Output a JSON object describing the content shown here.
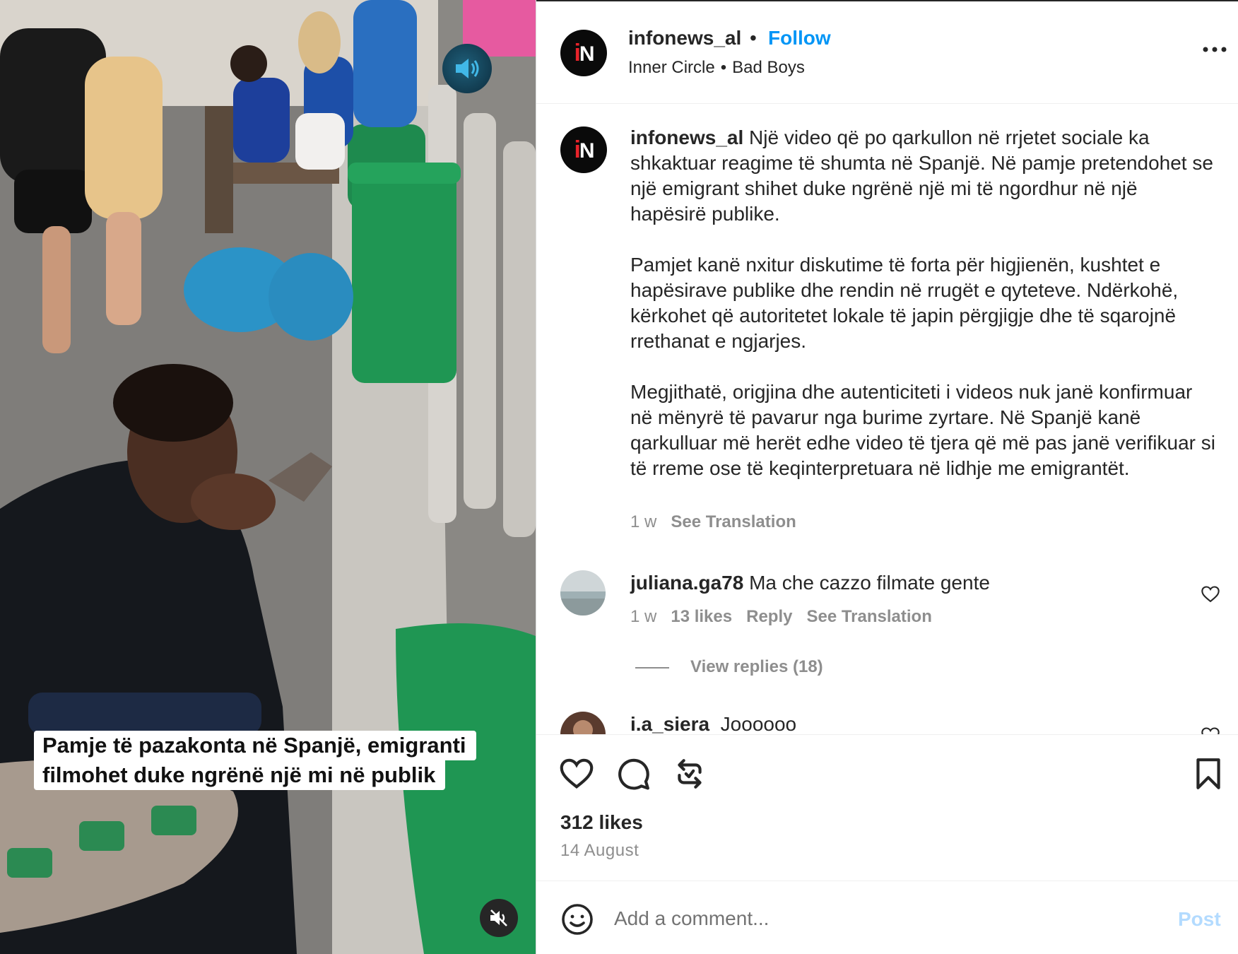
{
  "media": {
    "caption_line1": "Pamje të pazakonta në Spanjë, emigranti",
    "caption_line2": "filmohet duke ngrënë një mi në publik",
    "audio_icon": "speaker-icon",
    "mute_icon": "volume-muted-icon"
  },
  "header": {
    "avatar_text": "iN",
    "username": "infonews_al",
    "separator": "•",
    "follow": "Follow",
    "audio_artist": "Inner Circle",
    "audio_sep": "•",
    "audio_track": "Bad Boys",
    "more_icon": "more-horizontal-icon"
  },
  "caption": {
    "username": "infonews_al",
    "paragraph1": "Një video që po qarkullon në rrjetet sociale ka shkaktuar reagime të shumta në Spanjë. Në pamje pretendohet se një emigrant shihet duke ngrënë një mi të ngordhur në një hapësirë publike.",
    "paragraph2": "Pamjet kanë nxitur diskutime të forta për higjienën, kushtet e hapësirave publike dhe rendin në rrugët e qyteteve. Ndërkohë, kërkohet që autoritetet lokale të japin përgjigje dhe të sqarojnë rrethanat e ngjarjes.",
    "paragraph3": "Megjithatë, origjina dhe autenticiteti i videos nuk janë konfirmuar në mënyrë të pavarur nga burime zyrtare. Në Spanjë kanë qarkulluar më herët edhe video të tjera që më pas janë verifikuar si të rreme ose të keqinterpretuara në lidhje me emigrantët.",
    "time": "1 w",
    "see_translation": "See Translation"
  },
  "comments": [
    {
      "username": "juliana.ga78",
      "text": "Ma che cazzo filmate gente",
      "time": "1 w",
      "likes": "13 likes",
      "reply": "Reply",
      "see_translation": "See Translation",
      "view_replies": "View replies (18)"
    },
    {
      "username": "i.a_siera",
      "text": "Joooooo"
    }
  ],
  "actions": {
    "like_icon": "heart-icon",
    "comment_icon": "comment-icon",
    "repost_icon": "repost-icon",
    "save_icon": "bookmark-icon",
    "likes": "312 likes",
    "date": "14 August"
  },
  "add_comment": {
    "emoji_icon": "emoji-icon",
    "placeholder": "Add a comment...",
    "post": "Post"
  },
  "colors": {
    "link_blue": "#0095f6",
    "post_disabled": "#b3dbff",
    "muted_text": "#8e8e8e",
    "brand_red": "#e8232a"
  }
}
